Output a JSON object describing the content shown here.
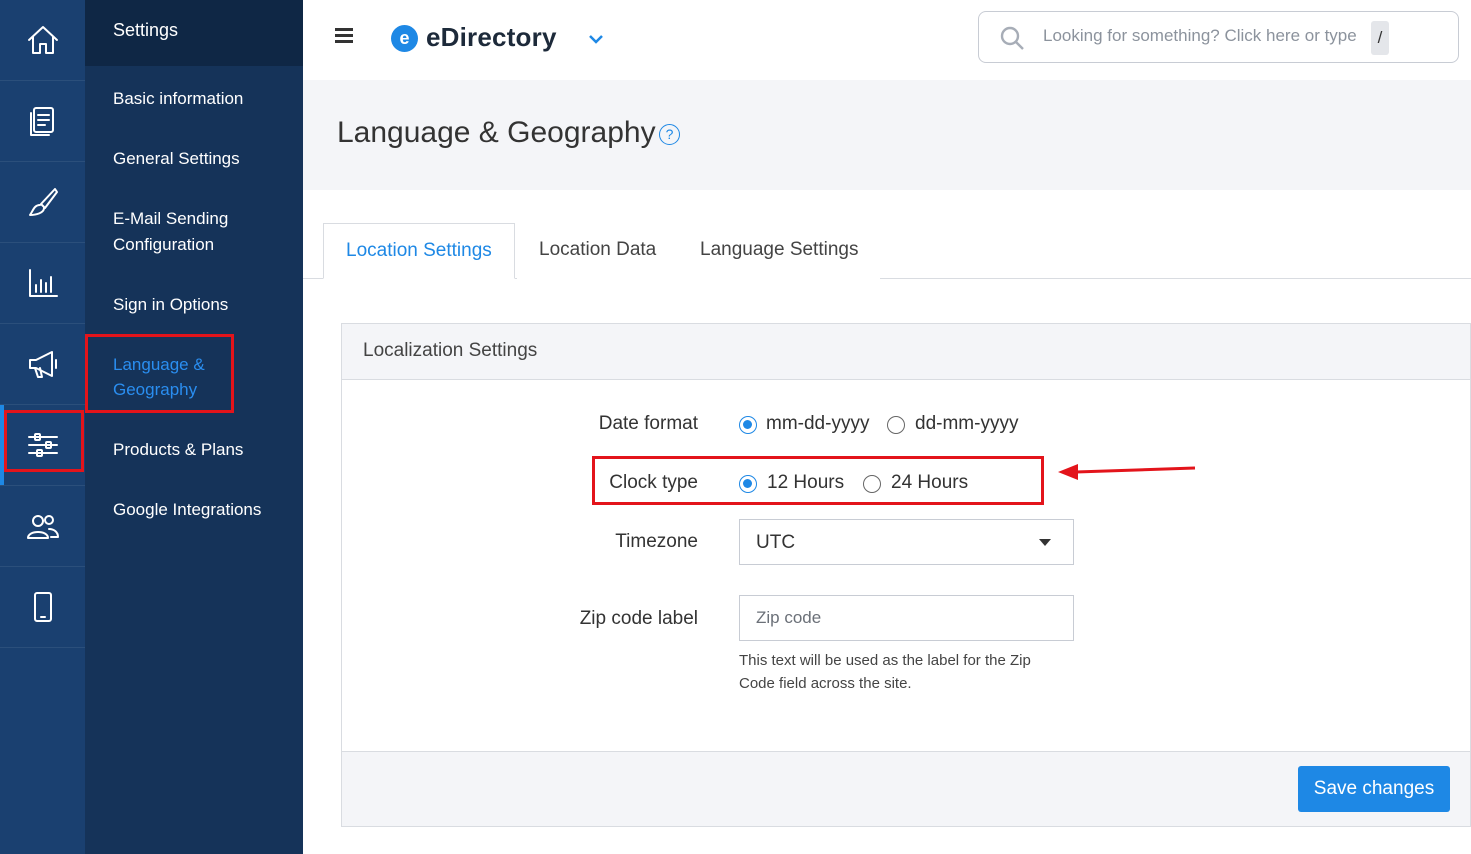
{
  "rail": {
    "items": [
      {
        "icon": "home-icon"
      },
      {
        "icon": "content-pages-icon"
      },
      {
        "icon": "design-brush-icon"
      },
      {
        "icon": "reports-chart-icon"
      },
      {
        "icon": "promotion-megaphone-icon"
      },
      {
        "icon": "settings-sliders-icon",
        "active": true
      },
      {
        "icon": "users-icon"
      },
      {
        "icon": "mobile-icon"
      }
    ]
  },
  "submenu": {
    "title": "Settings",
    "items": [
      {
        "label": "Basic information"
      },
      {
        "label": "General Settings"
      },
      {
        "label": "E-Mail Sending",
        "label2": "Configuration"
      },
      {
        "label": "Sign in Options"
      },
      {
        "label": "Language &",
        "label2": "Geography",
        "active": true
      },
      {
        "label": "Products & Plans"
      },
      {
        "label": "Google Integrations"
      }
    ]
  },
  "topbar": {
    "logo_mark": "e",
    "logo_text": "eDirectory",
    "search_placeholder": "Looking for something? Click here or type",
    "search_shortcut": "/"
  },
  "page": {
    "title": "Language & Geography",
    "help_glyph": "?"
  },
  "tabs": [
    {
      "label": "Location Settings",
      "active": true
    },
    {
      "label": "Location Data"
    },
    {
      "label": "Language Settings"
    }
  ],
  "panel": {
    "title": "Localization Settings",
    "date_format": {
      "label": "Date format",
      "options": [
        "mm-dd-yyyy",
        "dd-mm-yyyy"
      ],
      "selected": "mm-dd-yyyy"
    },
    "clock_type": {
      "label": "Clock type",
      "options": [
        "12 Hours",
        "24 Hours"
      ],
      "selected": "12 Hours"
    },
    "timezone": {
      "label": "Timezone",
      "value": "UTC"
    },
    "zip_code": {
      "label": "Zip code label",
      "placeholder": "Zip code",
      "help": "This text will be used as the label for the Zip Code field across the site."
    },
    "save_label": "Save changes"
  },
  "colors": {
    "accent": "#1e88e5",
    "rail_bg": "#1a4070",
    "submenu_bg": "#153359",
    "annotation_red": "#e3141b"
  }
}
